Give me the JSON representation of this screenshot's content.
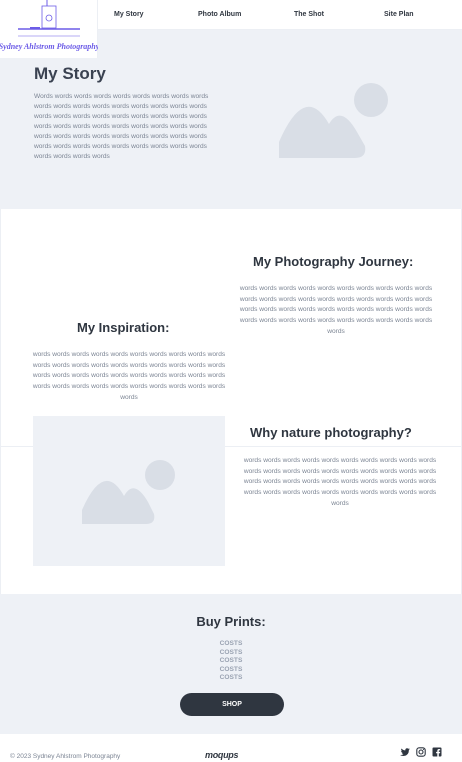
{
  "header": {
    "logo_text": "Sydney Ahlstrom Photography",
    "nav": [
      {
        "label": "My Story"
      },
      {
        "label": "Photo Album"
      },
      {
        "label": "The Shot"
      },
      {
        "label": "Site Plan"
      }
    ]
  },
  "hero": {
    "title": "My Story",
    "body": "Words words words words words words words words words words words words words words words words words words words words words words words words words words words words words words words words words words words words words words words words words words words words words words words words words words words words words words words words words words"
  },
  "journey": {
    "title": "My Photography Journey:",
    "body": "words words words words words words words words words words words words words words words words words words words words words words words words words words words words words words words words words words words words words words words words words"
  },
  "inspiration": {
    "title": "My Inspiration:",
    "body": "words words words words words words words words words words words words words words words words words words words words words words words words words words words words words words words words words words words words words words words words words"
  },
  "nature": {
    "title": "Why nature photography?",
    "body": "words words words words words words words words words words words words words words words words words words words words words words words words words words words words words words words words words words words words words words words words words"
  },
  "buy": {
    "title": "Buy Prints:",
    "costs": [
      "COSTS",
      "COSTS",
      "COSTS",
      "COSTS",
      "COSTS"
    ],
    "shop_label": "SHOP"
  },
  "footer": {
    "copyright": "© 2023 Sydney Ahlstrom Photography",
    "brand": "moqups"
  },
  "icons": {
    "image_placeholder": "image-placeholder-icon",
    "twitter": "twitter-icon",
    "instagram": "instagram-icon",
    "facebook": "facebook-icon"
  },
  "colors": {
    "section_bg": "#eef1f6",
    "placeholder": "#d9dee6",
    "text_dark": "#2f3640",
    "text_muted": "#7c8594",
    "logo_accent": "#6c5ce7"
  }
}
